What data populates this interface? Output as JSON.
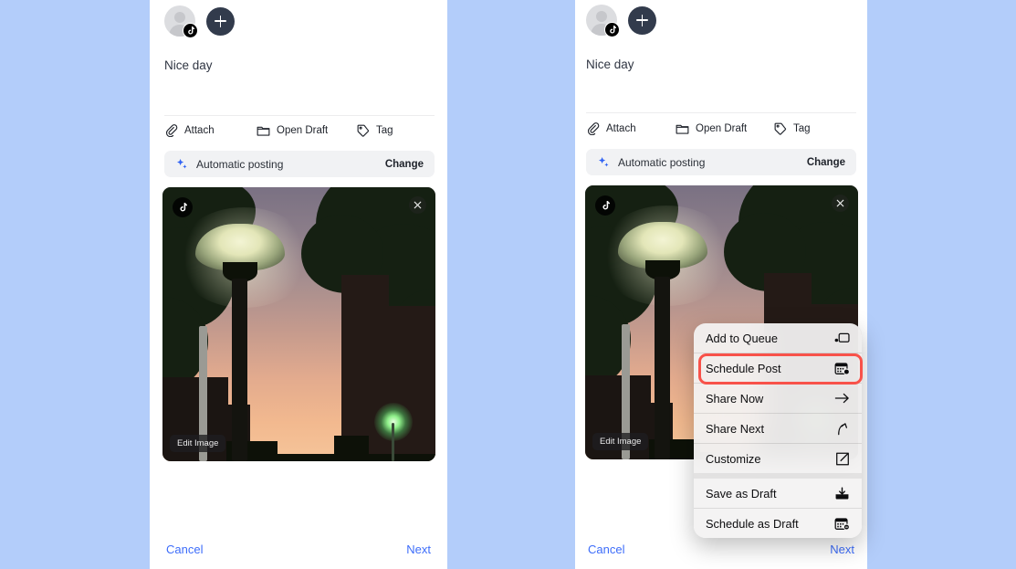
{
  "background_color": "#b3cdfa",
  "accent_blue": "#3d6dfa",
  "highlight_color": "#f8524a",
  "composer": {
    "account": {
      "avatar_name": "default-user-avatar",
      "platform_badge": "tiktok-icon",
      "add_account_label": "+"
    },
    "caption": "Nice day",
    "actions": [
      {
        "label": "Attach",
        "icon": "paperclip-icon"
      },
      {
        "label": "Open Draft",
        "icon": "folder-icon"
      },
      {
        "label": "Tag",
        "icon": "tag-icon"
      }
    ],
    "posting_bar": {
      "icon": "sparkle-icon",
      "label": "Automatic posting",
      "action_label": "Change"
    },
    "media": {
      "edit_label": "Edit Image",
      "platform_chip": "tiktok-icon",
      "remove_label": "×",
      "alt": "Street lamp at dusk with trees and apartment buildings against a purple-to-orange sunset sky"
    },
    "footer": {
      "cancel_label": "Cancel",
      "next_label": "Next"
    }
  },
  "context_menu": {
    "groups": [
      {
        "items": [
          {
            "label": "Add to Queue",
            "icon": "queue-icon",
            "highlighted": false
          },
          {
            "label": "Schedule Post",
            "icon": "calendar-clock-icon",
            "highlighted": true
          },
          {
            "label": "Share Now",
            "icon": "arrow-right-icon",
            "highlighted": false
          },
          {
            "label": "Share Next",
            "icon": "arrow-up-icon",
            "highlighted": false
          },
          {
            "label": "Customize",
            "icon": "pencil-square-icon",
            "highlighted": false
          }
        ]
      },
      {
        "items": [
          {
            "label": "Save as Draft",
            "icon": "tray-download-icon",
            "highlighted": false
          },
          {
            "label": "Schedule as Draft",
            "icon": "calendar-minus-icon",
            "highlighted": false
          }
        ]
      }
    ]
  }
}
